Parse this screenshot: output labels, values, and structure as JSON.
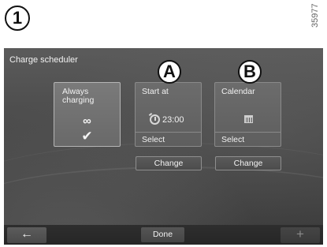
{
  "figure": {
    "number": "1",
    "reference": "35977"
  },
  "screen": {
    "title": "Charge scheduler",
    "options": [
      {
        "label": "Always charging",
        "icon": "infinity-icon",
        "selected_icon": "checkmark-icon",
        "selected": true
      },
      {
        "label": "Start at",
        "icon": "clock-icon",
        "time": "23:00",
        "action": "Select",
        "callout": "A"
      },
      {
        "label": "Calendar",
        "icon": "calendar-icon",
        "action": "Select",
        "callout": "B"
      }
    ],
    "change_buttons": [
      "Change",
      "Change"
    ],
    "bottom_bar": {
      "back_icon": "arrow-left-icon",
      "done_label": "Done",
      "add_icon": "plus-icon"
    }
  },
  "glyphs": {
    "infinity": "∞",
    "check": "✔",
    "back": "←",
    "plus": "+"
  }
}
